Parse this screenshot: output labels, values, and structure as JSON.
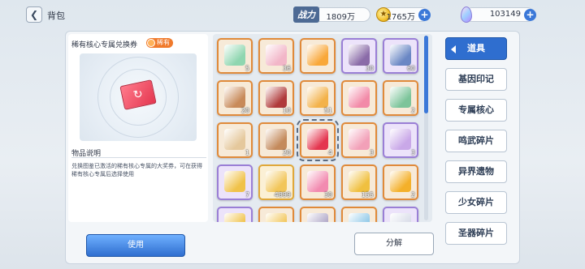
{
  "header": {
    "title": "背包",
    "power_label": "战力",
    "power_value": "1809万",
    "coins_value": "1765万",
    "gems_value": "103149"
  },
  "detail": {
    "item_name": "稀有核心专属兑换券",
    "rarity": "稀有",
    "desc_title": "物品说明",
    "desc_text": "兑换图鉴已激活的稀有核心专属的大奖券，可在获得稀有核心专属后选择使用"
  },
  "grid": {
    "items": [
      {
        "count": "5",
        "color": "#8fd6b0",
        "frame": "orange"
      },
      {
        "count": "36",
        "color": "#f2b6c8",
        "frame": "orange"
      },
      {
        "count": "",
        "color": "#f9a83a",
        "frame": "orange"
      },
      {
        "count": "30",
        "color": "#8a6ba8",
        "frame": "purple"
      },
      {
        "count": "60",
        "color": "#6a87c4",
        "frame": "purple"
      },
      {
        "count": "20",
        "color": "#c88a5a",
        "frame": "orange"
      },
      {
        "count": "10",
        "color": "#b03a3a",
        "frame": "orange"
      },
      {
        "count": "51",
        "color": "#f3b24a",
        "frame": "orange"
      },
      {
        "count": "",
        "color": "#f28aa8",
        "frame": "orange"
      },
      {
        "count": "2",
        "color": "#7cc49a",
        "frame": "orange"
      },
      {
        "count": "1",
        "color": "#e5c89c",
        "frame": "orange"
      },
      {
        "count": "20",
        "color": "#c48a5c",
        "frame": "orange"
      },
      {
        "count": "4",
        "color": "#e4364f",
        "frame": "orange"
      },
      {
        "count": "3",
        "color": "#f2a0b8",
        "frame": "orange"
      },
      {
        "count": "3",
        "color": "#c9a8e8",
        "frame": "purple"
      },
      {
        "count": "7",
        "color": "#f0c24a",
        "frame": "purple"
      },
      {
        "count": "4899",
        "color": "#f2c65a",
        "frame": "gold"
      },
      {
        "count": "30",
        "color": "#f28ab0",
        "frame": "orange"
      },
      {
        "count": "155",
        "color": "#f0c040",
        "frame": "orange"
      },
      {
        "count": "2",
        "color": "#f4b02a",
        "frame": "orange"
      },
      {
        "count": "",
        "color": "#f0c24a",
        "frame": "purple"
      },
      {
        "count": "",
        "color": "#f2c65a",
        "frame": "orange"
      },
      {
        "count": "",
        "color": "#b0a8c8",
        "frame": "orange"
      },
      {
        "count": "",
        "color": "#8fc8e8",
        "frame": "orange"
      },
      {
        "count": "",
        "color": "#d8dce8",
        "frame": "purple"
      }
    ]
  },
  "categories": [
    {
      "label": "道具",
      "active": true
    },
    {
      "label": "基因印记",
      "active": false
    },
    {
      "label": "专属核心",
      "active": false
    },
    {
      "label": "鸣武碎片",
      "active": false
    },
    {
      "label": "异界遗物",
      "active": false
    },
    {
      "label": "少女碎片",
      "active": false
    },
    {
      "label": "圣器碎片",
      "active": false
    }
  ],
  "buttons": {
    "use": "使用",
    "split": "分解"
  }
}
